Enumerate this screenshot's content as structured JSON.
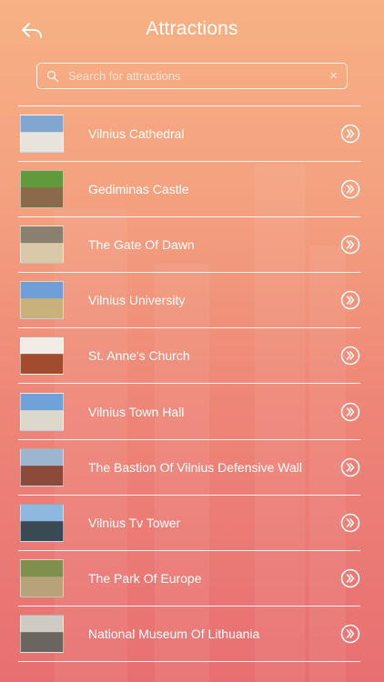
{
  "header": {
    "title": "Attractions",
    "back_icon": "back-arrow-icon"
  },
  "search": {
    "placeholder": "Search for attractions",
    "value": "",
    "clear_icon": "clear-icon"
  },
  "attractions": [
    {
      "label": "Vilnius Cathedral",
      "thumb_color": "#7fa7cf",
      "thumb_accent": "#e8e4dc"
    },
    {
      "label": "Gediminas Castle",
      "thumb_color": "#5f9a3c",
      "thumb_accent": "#8a6a4a"
    },
    {
      "label": "The Gate Of Dawn",
      "thumb_color": "#8b7f70",
      "thumb_accent": "#d9c9a8"
    },
    {
      "label": "Vilnius University",
      "thumb_color": "#6f9fd6",
      "thumb_accent": "#c9b27a"
    },
    {
      "label": "St. Anne's Church",
      "thumb_color": "#f1ede6",
      "thumb_accent": "#a24b2e"
    },
    {
      "label": "Vilnius Town Hall",
      "thumb_color": "#6fa2d8",
      "thumb_accent": "#ddd8cc"
    },
    {
      "label": "The Bastion Of Vilnius Defensive Wall",
      "thumb_color": "#9cb6d0",
      "thumb_accent": "#8b4a3a"
    },
    {
      "label": "Vilnius Tv Tower",
      "thumb_color": "#8fb8e0",
      "thumb_accent": "#3a4a55"
    },
    {
      "label": "The Park Of Europe",
      "thumb_color": "#7e8f4e",
      "thumb_accent": "#b8a27a"
    },
    {
      "label": "National Museum Of Lithuania",
      "thumb_color": "#cfcac2",
      "thumb_accent": "#6b6560"
    }
  ],
  "row_action_icon": "chevron-right-circle-icon"
}
